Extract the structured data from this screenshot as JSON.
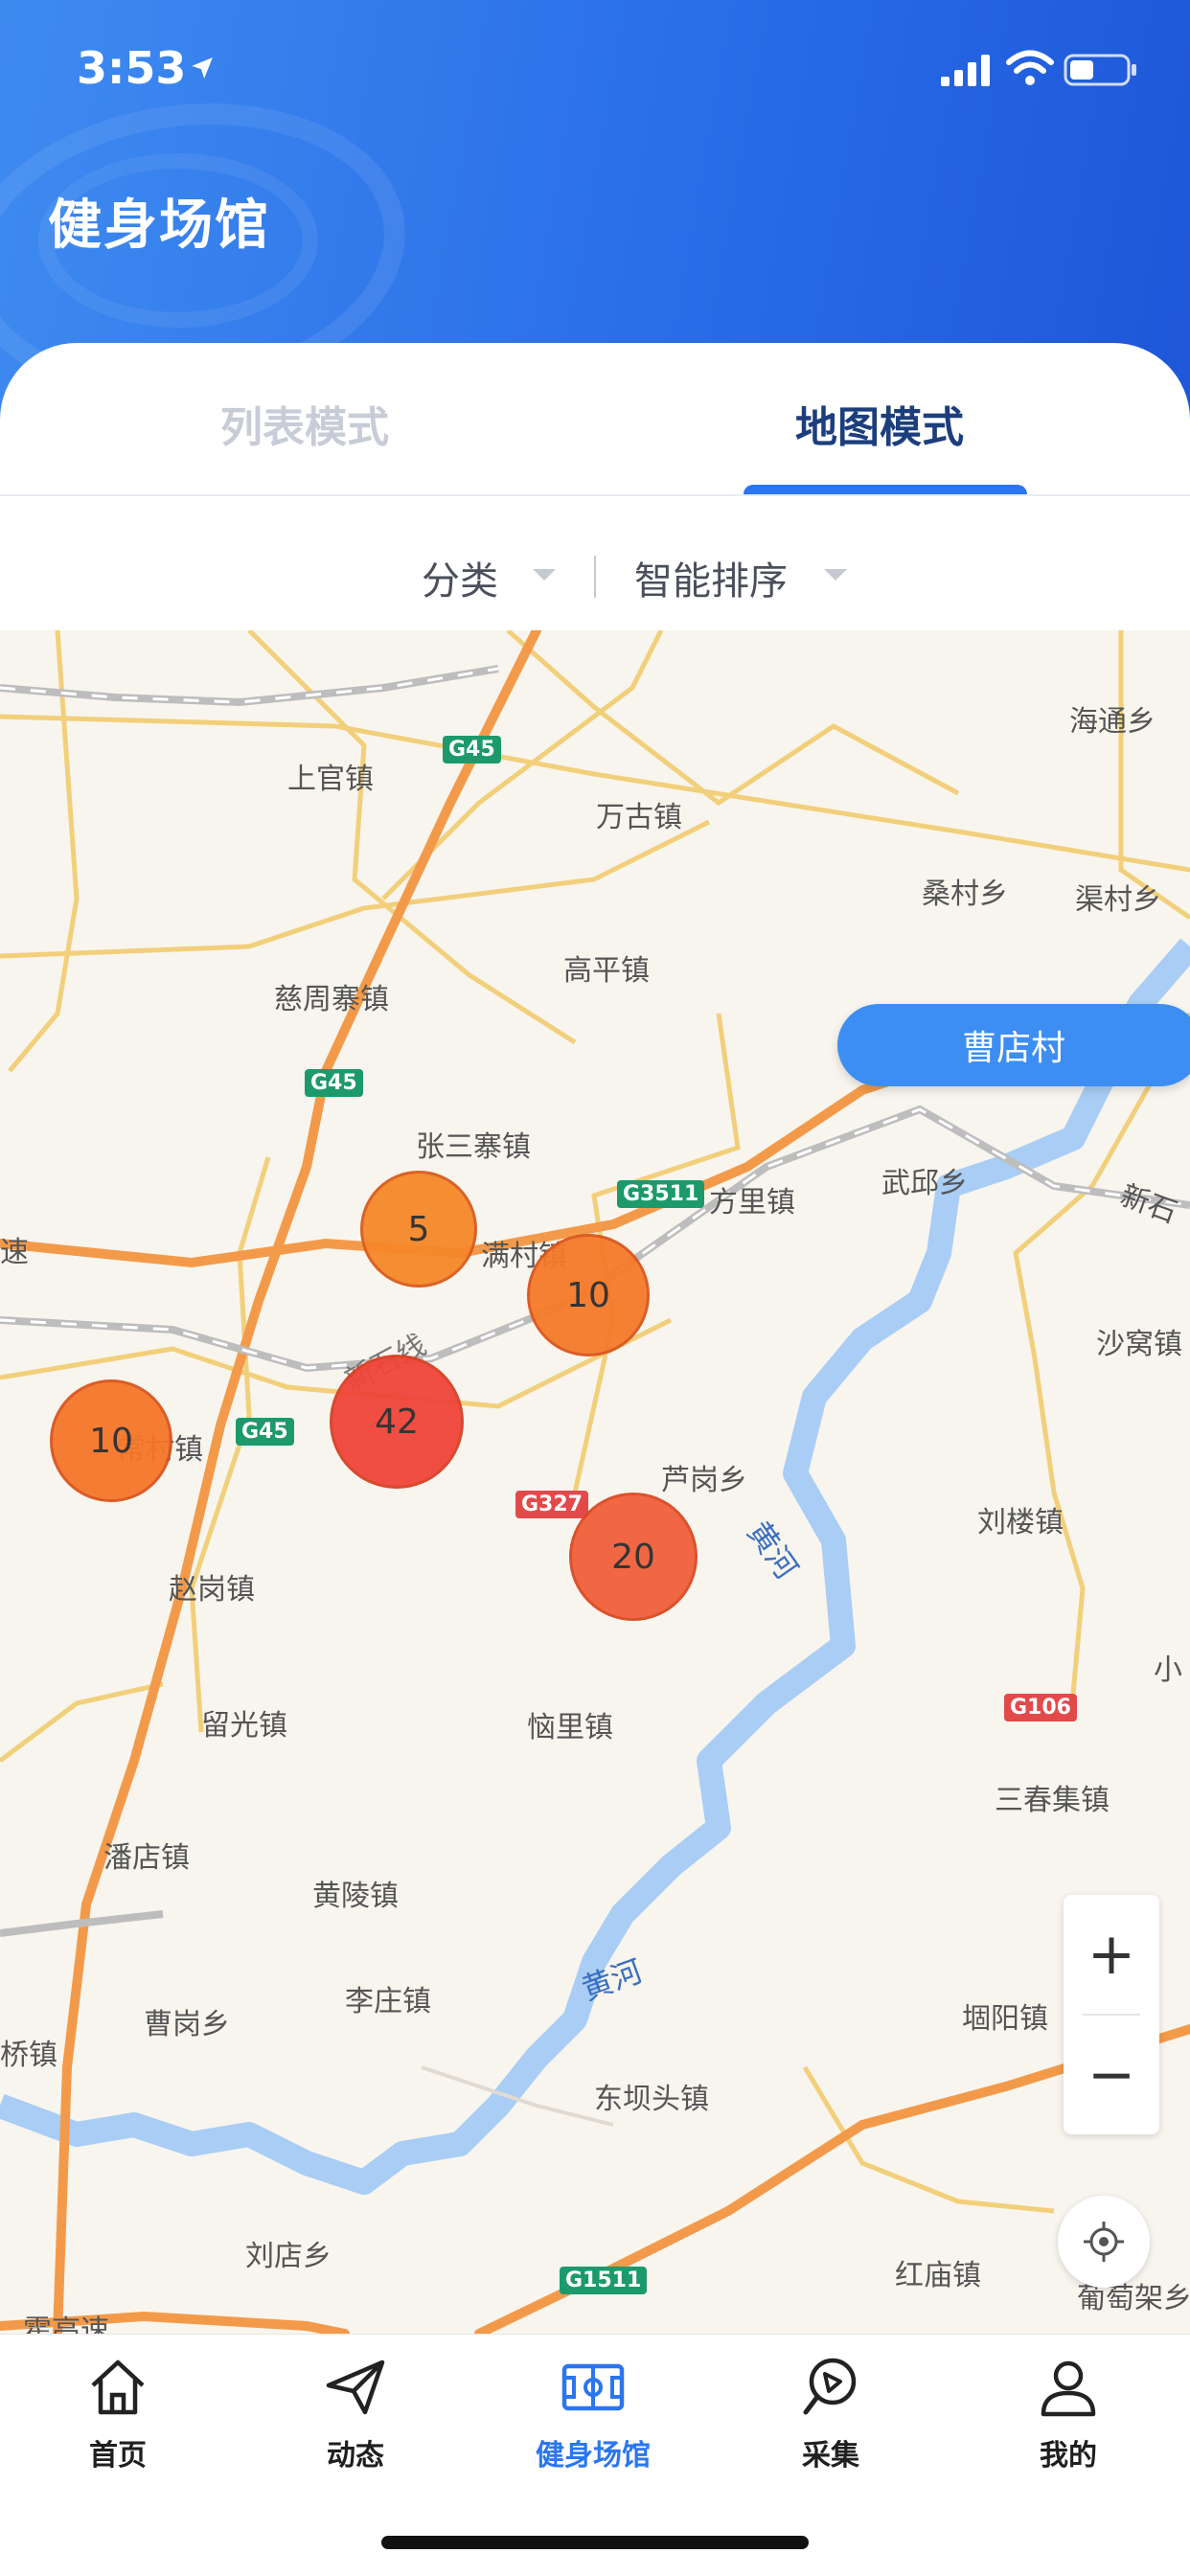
{
  "status_bar": {
    "time": "3:53"
  },
  "header": {
    "title": "健身场馆"
  },
  "tabs": [
    {
      "label": "列表模式",
      "active": false
    },
    {
      "label": "地图模式",
      "active": true
    }
  ],
  "filters": {
    "category": "分类",
    "sort": "智能排序"
  },
  "map": {
    "places": [
      "上官镇",
      "万古镇",
      "海通乡",
      "桑村乡",
      "渠村乡",
      "慈周寨镇",
      "高平镇",
      "张三寨镇",
      "方里镇",
      "武邱乡",
      "满村镇",
      "新石",
      "沙窝镇",
      "常村镇",
      "赵岗镇",
      "芦岗乡",
      "刘楼镇",
      "留光镇",
      "恼里镇",
      "小",
      "三春集镇",
      "潘店镇",
      "黄陵镇",
      "李庄镇",
      "曹岗乡",
      "东坝头镇",
      "堌阳镇",
      "桥镇",
      "刘店乡",
      "红庙镇",
      "葡萄架乡",
      "霍高速",
      "新石线",
      "速"
    ],
    "rivers": [
      "黄河",
      "黄河"
    ],
    "road_shields": [
      "G45",
      "G45",
      "G45",
      "G3511",
      "G327",
      "G106",
      "G1511"
    ],
    "clusters": [
      {
        "count": "5",
        "color": "#f5882a"
      },
      {
        "count": "10",
        "color": "#f57a2a"
      },
      {
        "count": "10",
        "color": "#f5772a"
      },
      {
        "count": "42",
        "color": "#f0453a"
      },
      {
        "count": "20",
        "color": "#f2603a"
      }
    ],
    "callout": "曹店村"
  },
  "zoom": {
    "plus": "+",
    "minus": "−"
  },
  "nav": [
    {
      "label": "首页",
      "icon": "home-icon",
      "active": false
    },
    {
      "label": "动态",
      "icon": "send-icon",
      "active": false
    },
    {
      "label": "健身场馆",
      "icon": "stadium-icon",
      "active": true
    },
    {
      "label": "采集",
      "icon": "collect-icon",
      "active": false
    },
    {
      "label": "我的",
      "icon": "user-icon",
      "active": false
    }
  ]
}
